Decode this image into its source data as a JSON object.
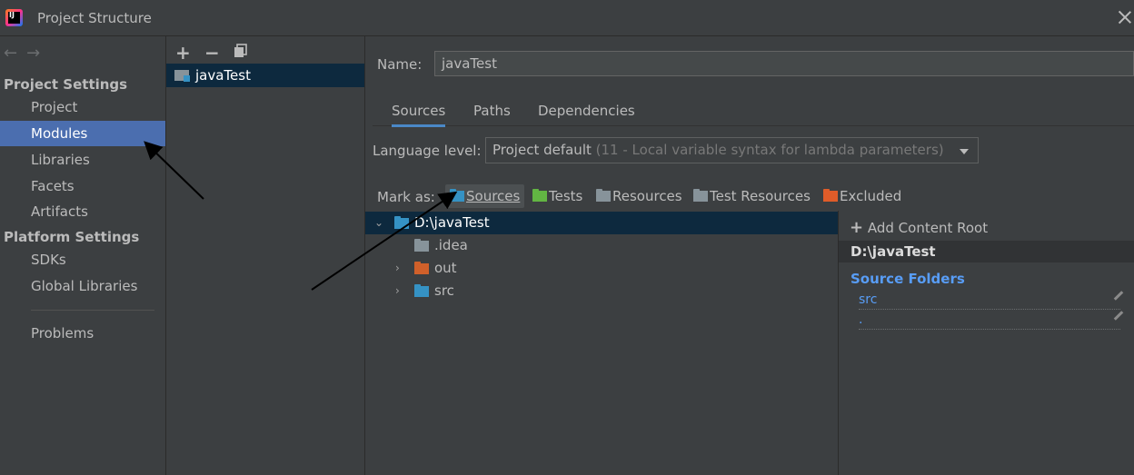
{
  "window": {
    "title": "Project Structure",
    "app_icon": "intellij-icon",
    "close_icon": "close-icon"
  },
  "nav": {
    "back_icon": "arrow-left-icon",
    "forward_icon": "arrow-right-icon",
    "project_settings_header": "Project Settings",
    "project_settings_items": [
      "Project",
      "Modules",
      "Libraries",
      "Facets",
      "Artifacts"
    ],
    "platform_settings_header": "Platform Settings",
    "platform_settings_items": [
      "SDKs",
      "Global Libraries"
    ],
    "problems_label": "Problems",
    "selected": "Modules"
  },
  "modules_panel": {
    "toolbar": [
      "add-icon",
      "remove-icon",
      "copy-icon"
    ],
    "modules": [
      "javaTest"
    ]
  },
  "module_detail": {
    "name_label": "Name:",
    "name_value": "javaTest",
    "tabs": [
      "Sources",
      "Paths",
      "Dependencies"
    ],
    "active_tab": "Sources",
    "language_level_label": "Language level:",
    "language_level_value": "Project default",
    "language_level_hint": "(11 - Local variable syntax for lambda parameters)",
    "mark_as_label": "Mark as:",
    "mark_as_buttons": [
      {
        "label": "Sources",
        "color": "#3592c4"
      },
      {
        "label": "Tests",
        "color": "#62b543"
      },
      {
        "label": "Resources",
        "color": "#87939a"
      },
      {
        "label": "Test Resources",
        "color": "#87939a"
      },
      {
        "label": "Excluded",
        "color": "#e05c29"
      }
    ],
    "tree": {
      "root": "D:\\javaTest",
      "children": [
        ".idea",
        "out",
        "src"
      ]
    },
    "content_roots": {
      "add_label": "Add Content Root",
      "root_path": "D:\\javaTest",
      "source_folders_title": "Source Folders",
      "source_folders": [
        "src",
        "."
      ]
    }
  },
  "colors": {
    "selection": "#4b6eaf",
    "tree_selection": "#0d293e",
    "link": "#589df6"
  }
}
